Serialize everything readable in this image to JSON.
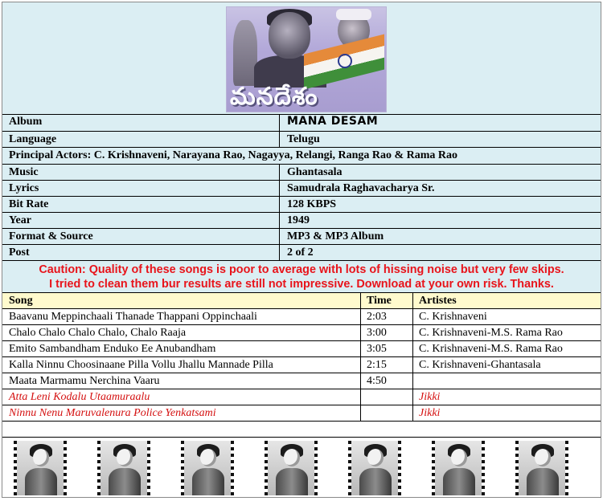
{
  "poster": {
    "logo_text": "మనదేశం"
  },
  "info": {
    "album": {
      "label": "Album",
      "value": "MANA DESAM"
    },
    "language": {
      "label": "Language",
      "value": "Telugu"
    },
    "actors": "Principal Actors: C. Krishnaveni, Narayana Rao, Nagayya, Relangi, Ranga Rao & Rama Rao",
    "music": {
      "label": "Music",
      "value": "Ghantasala"
    },
    "lyrics": {
      "label": "Lyrics",
      "value": "Samudrala Raghavacharya Sr."
    },
    "bitrate": {
      "label": "Bit Rate",
      "value": "128 KBPS"
    },
    "year": {
      "label": "Year",
      "value": "1949"
    },
    "format": {
      "label": "Format & Source",
      "value": "MP3 & MP3 Album"
    },
    "post": {
      "label": "Post",
      "value": "2 of 2"
    }
  },
  "caution": {
    "line1": "Caution:  Quality of these songs is poor to average with lots of hissing noise but very few skips.",
    "line2": "I tried to clean them bur results are still not impressive.  Download at your own risk.  Thanks."
  },
  "songs": {
    "headers": {
      "song": "Song",
      "time": "Time",
      "artistes": "Artistes"
    },
    "rows": [
      {
        "song": "Baavanu Meppinchaali Thanade Thappani Oppinchaali",
        "time": "2:03",
        "artistes": "C. Krishnaveni"
      },
      {
        "song": "Chalo Chalo Chalo Chalo, Chalo Raaja",
        "time": "3:00",
        "artistes": "C. Krishnaveni-M.S. Rama Rao"
      },
      {
        "song": "Emito Sambandham Enduko Ee Anubandham",
        "time": "3:05",
        "artistes": "C. Krishnaveni-M.S. Rama Rao"
      },
      {
        "song": "Kalla Ninnu Choosinaane Pilla Vollu Jhallu Mannade Pilla",
        "time": "2:15",
        "artistes": "C. Krishnaveni-Ghantasala"
      },
      {
        "song": "Maata Marmamu Nerchina Vaaru",
        "time": "4:50",
        "artistes": ""
      },
      {
        "song": "Atta Leni Kodalu Utaamuraalu",
        "time": "",
        "artistes": "Jikki"
      },
      {
        "song": "Ninnu Nenu Maruvalenura Police Yenkatsami",
        "time": "",
        "artistes": "Jikki"
      }
    ]
  },
  "colors": {
    "table_bg": "#dbeef3",
    "header_bg": "#fffacd",
    "caution": "#e8141b",
    "missing_song": "#d40f0f"
  }
}
